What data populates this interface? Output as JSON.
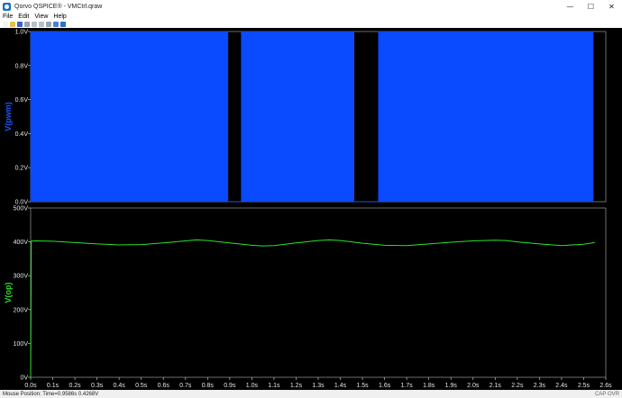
{
  "window": {
    "title": "Qorvo QSPICE® - VMCtrl.qraw",
    "minimize_glyph": "—",
    "maximize_glyph": "☐",
    "close_glyph": "✕"
  },
  "menu": [
    {
      "label": "File"
    },
    {
      "label": "Edit"
    },
    {
      "label": "View"
    },
    {
      "label": "Help"
    }
  ],
  "toolbar": {
    "buttons": [
      {
        "icon": "new-file-icon",
        "color": "#f2f2f2"
      },
      {
        "icon": "open-folder-icon",
        "color": "#e8c04a"
      },
      {
        "icon": "save-icon",
        "color": "#3a62c9"
      },
      {
        "icon": "print-icon",
        "color": "#9aa4b0"
      },
      {
        "icon": "cut-icon",
        "color": "#b8bec6"
      },
      {
        "icon": "copy-icon",
        "color": "#b8bec6"
      },
      {
        "icon": "zoom-fit-icon",
        "color": "#9aa4b0"
      },
      {
        "icon": "zoom-icon",
        "color": "#4a7fd1"
      },
      {
        "icon": "help-icon",
        "color": "#2f6fce"
      }
    ]
  },
  "chart_data": [
    {
      "type": "area",
      "ylabel": "V(pwm)",
      "ylim": [
        0,
        1
      ],
      "y_ticks": [
        "0.0V",
        "0.2V",
        "0.4V",
        "0.6V",
        "0.8V",
        "1.0V"
      ],
      "xlim": [
        0,
        2.6
      ],
      "grid": false,
      "trace_color": "#0a4bff",
      "label_color": "#1b57ff",
      "series": [
        {
          "x": [
            0,
            0.0,
            0.892,
            0.892,
            0.952,
            0.952,
            1.462,
            1.462,
            1.572,
            1.572,
            2.543,
            2.543
          ],
          "y": [
            0,
            1,
            1,
            0,
            0,
            1,
            1,
            0,
            0,
            1,
            1,
            0
          ]
        }
      ]
    },
    {
      "type": "line",
      "ylabel": "V(op)",
      "ylim": [
        0,
        500
      ],
      "y_ticks": [
        "0V",
        "100V",
        "200V",
        "300V",
        "400V",
        "500V"
      ],
      "xlim": [
        0,
        2.6
      ],
      "x_ticks": [
        "0.0s",
        "0.1s",
        "0.2s",
        "0.3s",
        "0.4s",
        "0.5s",
        "0.6s",
        "0.7s",
        "0.8s",
        "0.9s",
        "1.0s",
        "1.1s",
        "1.2s",
        "1.3s",
        "1.4s",
        "1.5s",
        "1.6s",
        "1.7s",
        "1.8s",
        "1.9s",
        "2.0s",
        "2.1s",
        "2.2s",
        "2.3s",
        "2.4s",
        "2.5s",
        "2.6s"
      ],
      "grid": false,
      "trace_color": "#29e329",
      "label_color": "#2de02d",
      "series": [
        {
          "x": [
            0,
            0.003,
            0.02,
            0.1,
            0.2,
            0.3,
            0.4,
            0.5,
            0.6,
            0.7,
            0.75,
            0.8,
            0.9,
            1.0,
            1.05,
            1.1,
            1.2,
            1.3,
            1.35,
            1.4,
            1.5,
            1.6,
            1.7,
            1.8,
            1.9,
            2.0,
            2.1,
            2.15,
            2.2,
            2.3,
            2.4,
            2.5,
            2.55
          ],
          "y": [
            0,
            402,
            403,
            402,
            398,
            394,
            391,
            392,
            397,
            403,
            406,
            404,
            397,
            390,
            388,
            389,
            397,
            404,
            406,
            404,
            396,
            390,
            389,
            394,
            399,
            403,
            405,
            404,
            400,
            394,
            389,
            393,
            398
          ]
        }
      ]
    }
  ],
  "status": {
    "mouse_position": "Mouse Position: Time=0.9586s  0.4268V",
    "keys": "CAP  OVR"
  }
}
